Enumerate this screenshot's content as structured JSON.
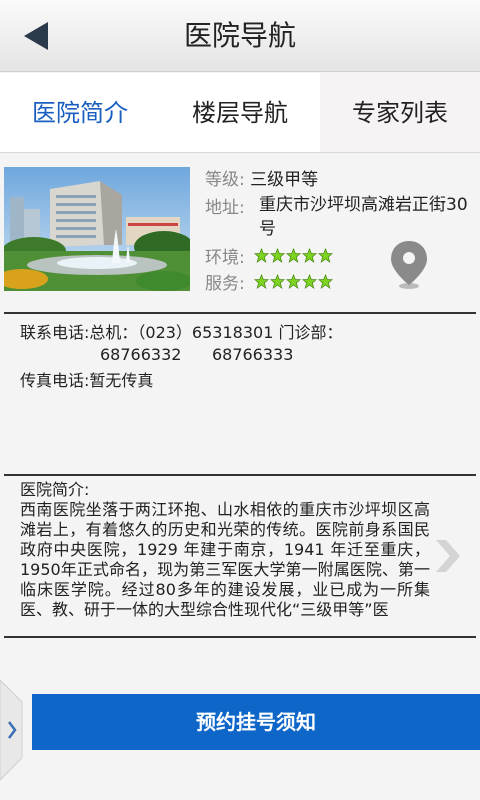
{
  "header": {
    "title": "医院导航"
  },
  "tabs": [
    {
      "label": "医院简介"
    },
    {
      "label": "楼层导航"
    },
    {
      "label": "专家列表"
    }
  ],
  "info": {
    "level_label": "等级:",
    "level_value": "三级甲等",
    "address_label": "地址:",
    "address_value": "重庆市沙坪坝高滩岩正街30号",
    "environment_label": "环境:",
    "environment_rating": 5,
    "service_label": "服务:",
    "service_rating": 5
  },
  "contact": {
    "phone_line1": "联系电话:总机：（023）65318301 门诊部：",
    "phone_line2": "68766332      68766333",
    "fax": "传真电话:暂无传真"
  },
  "intro": {
    "heading": "医院简介:",
    "text": "西南医院坐落于两江环抱、山水相依的重庆市沙坪坝区高滩岩上，有着悠久的历史和光荣的传统。医院前身系国民政府中央医院，1929 年建于南京，1941 年迁至重庆，1950年正式命名，现为第三军医大学第一附属医院、第一临床医学院。经过80多年的建设发展，业已成为一所集医、教、研于一体的大型综合性现代化“三级甲等”医"
  },
  "booking_button": {
    "label": "预约挂号须知"
  },
  "colors": {
    "accent": "#1a5fc0",
    "button": "#0e66c9",
    "star": "#7ed321"
  }
}
